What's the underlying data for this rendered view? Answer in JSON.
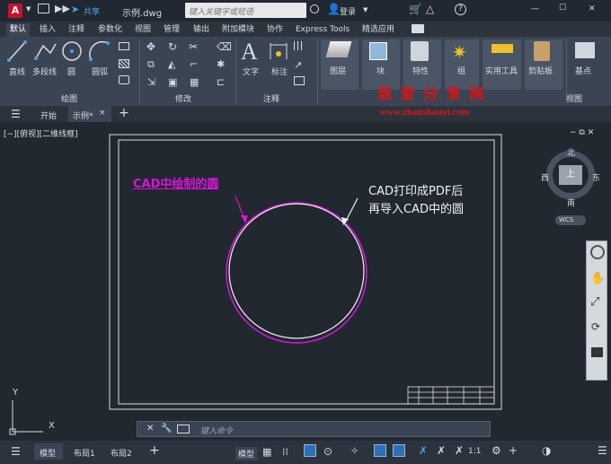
{
  "titlebar": {
    "app_letter": "A",
    "share": "共享",
    "file": "示例.dwg",
    "search_placeholder": "键入关键字或短语",
    "login": "登录",
    "min": "—",
    "max": "☐",
    "close": "✕"
  },
  "ribbon_tabs": [
    "默认",
    "插入",
    "注释",
    "参数化",
    "视图",
    "管理",
    "输出",
    "附加模块",
    "协作",
    "Express Tools",
    "精选应用"
  ],
  "draw_panel": {
    "line": "直线",
    "polyline": "多段线",
    "circle": "圆",
    "arc": "圆弧",
    "label": "绘图"
  },
  "modify_panel": {
    "label": "修改"
  },
  "annotate_panel": {
    "text": "文字",
    "dim": "标注",
    "label": "注释"
  },
  "layers": "图层",
  "block": "块",
  "properties": "特性",
  "group": "组",
  "utilities": "实用工具",
  "clipboard": "剪贴板",
  "view_base": "基点",
  "view_label": "视图",
  "watermark": {
    "title": "我 爱 分 享 网",
    "url": "www.zhanshaoyi.com"
  },
  "doc_tabs": {
    "start": "开始",
    "current": "示例*",
    "plus": "+"
  },
  "viewport_label": "[−][俯视][二维线框]",
  "annotations": {
    "left": "CAD中绘制的圆",
    "right1": "CAD打印成PDF后",
    "right2": "再导入CAD中的圆"
  },
  "viewcube": {
    "north": "北",
    "south": "南",
    "east": "东",
    "west": "西",
    "top": "上",
    "wcs": "WCS"
  },
  "ucs": {
    "x": "X",
    "y": "Y"
  },
  "command_placeholder": "键入命令",
  "status": {
    "model": "模型",
    "layout1": "布局1",
    "layout2": "布局2",
    "plus": "+",
    "model_btn": "模型",
    "scale": "1:1"
  },
  "colors": {
    "accent": "#e5213b",
    "magenta": "#d815d8",
    "watermark": "#e01212"
  }
}
